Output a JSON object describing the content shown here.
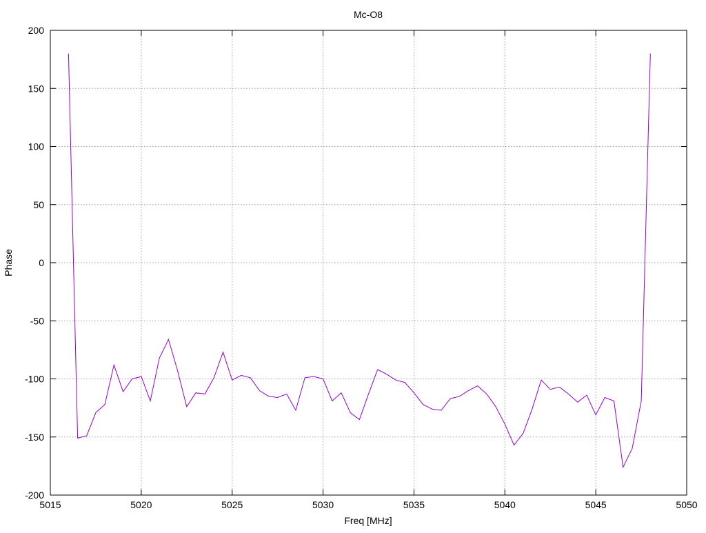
{
  "chart_data": {
    "type": "line",
    "title": "Mc-O8",
    "xlabel": "Freq [MHz]",
    "ylabel": "Phase",
    "xlim": [
      5015,
      5050
    ],
    "ylim": [
      -200,
      200
    ],
    "x_ticks": [
      5015,
      5020,
      5025,
      5030,
      5035,
      5040,
      5045,
      5050
    ],
    "y_ticks": [
      -200,
      -150,
      -100,
      -50,
      0,
      50,
      100,
      150,
      200
    ],
    "grid": true,
    "series_color": "#9400d3",
    "series": [
      {
        "x": [
          5016.0,
          5016.5,
          5017.0,
          5017.5,
          5018.0,
          5018.5,
          5019.0,
          5019.5,
          5020.0,
          5020.5,
          5021.0,
          5021.5,
          5022.0,
          5022.5,
          5023.0,
          5023.5,
          5024.0,
          5024.5,
          5025.0,
          5025.5,
          5026.0,
          5026.5,
          5027.0,
          5027.5,
          5028.0,
          5028.5,
          5029.0,
          5029.5,
          5030.0,
          5030.5,
          5031.0,
          5031.5,
          5032.0,
          5032.5,
          5033.0,
          5033.5,
          5034.0,
          5034.5,
          5035.0,
          5035.5,
          5036.0,
          5036.5,
          5037.0,
          5037.5,
          5038.0,
          5038.5,
          5039.0,
          5039.5,
          5040.0,
          5040.5,
          5041.0,
          5041.5,
          5042.0,
          5042.5,
          5043.0,
          5043.5,
          5044.0,
          5044.5,
          5045.0,
          5045.5,
          5046.0,
          5046.5,
          5047.0,
          5047.5,
          5048.0
        ],
        "values": [
          180,
          -151,
          -149,
          -129,
          -122,
          -88,
          -111,
          -100,
          -98,
          -119,
          -82,
          -66,
          -93,
          -124,
          -112,
          -113,
          -99,
          -77,
          -101,
          -97,
          -99,
          -110,
          -115,
          -116,
          -113,
          -127,
          -99,
          -98,
          -100,
          -119,
          -112,
          -129,
          -135,
          -113,
          -92,
          -96,
          -101,
          -103,
          -112,
          -122,
          -126,
          -127,
          -117,
          -115,
          -110,
          -106,
          -113,
          -124,
          -139,
          -157,
          -147,
          -126,
          -101,
          -109,
          -107,
          -113,
          -120,
          -114,
          -131,
          -116,
          -119,
          -176,
          -160,
          -119,
          180
        ]
      }
    ]
  }
}
